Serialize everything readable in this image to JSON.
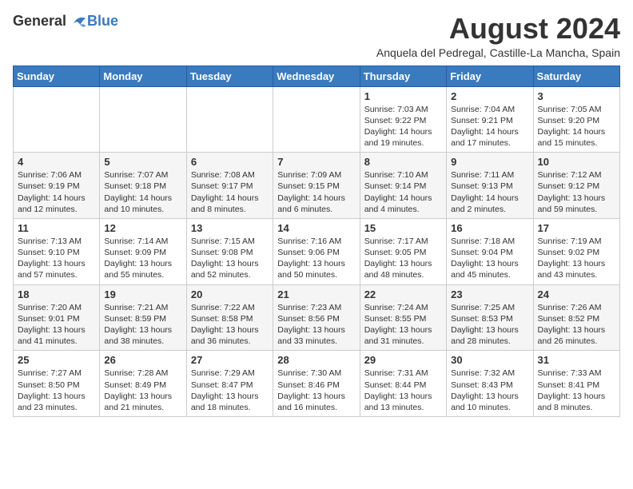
{
  "logo": {
    "general": "General",
    "blue": "Blue"
  },
  "title": "August 2024",
  "subtitle": "Anquela del Pedregal, Castille-La Mancha, Spain",
  "days_of_week": [
    "Sunday",
    "Monday",
    "Tuesday",
    "Wednesday",
    "Thursday",
    "Friday",
    "Saturday"
  ],
  "weeks": [
    [
      {
        "day": "",
        "info": ""
      },
      {
        "day": "",
        "info": ""
      },
      {
        "day": "",
        "info": ""
      },
      {
        "day": "",
        "info": ""
      },
      {
        "day": "1",
        "info": "Sunrise: 7:03 AM\nSunset: 9:22 PM\nDaylight: 14 hours and 19 minutes."
      },
      {
        "day": "2",
        "info": "Sunrise: 7:04 AM\nSunset: 9:21 PM\nDaylight: 14 hours and 17 minutes."
      },
      {
        "day": "3",
        "info": "Sunrise: 7:05 AM\nSunset: 9:20 PM\nDaylight: 14 hours and 15 minutes."
      }
    ],
    [
      {
        "day": "4",
        "info": "Sunrise: 7:06 AM\nSunset: 9:19 PM\nDaylight: 14 hours and 12 minutes."
      },
      {
        "day": "5",
        "info": "Sunrise: 7:07 AM\nSunset: 9:18 PM\nDaylight: 14 hours and 10 minutes."
      },
      {
        "day": "6",
        "info": "Sunrise: 7:08 AM\nSunset: 9:17 PM\nDaylight: 14 hours and 8 minutes."
      },
      {
        "day": "7",
        "info": "Sunrise: 7:09 AM\nSunset: 9:15 PM\nDaylight: 14 hours and 6 minutes."
      },
      {
        "day": "8",
        "info": "Sunrise: 7:10 AM\nSunset: 9:14 PM\nDaylight: 14 hours and 4 minutes."
      },
      {
        "day": "9",
        "info": "Sunrise: 7:11 AM\nSunset: 9:13 PM\nDaylight: 14 hours and 2 minutes."
      },
      {
        "day": "10",
        "info": "Sunrise: 7:12 AM\nSunset: 9:12 PM\nDaylight: 13 hours and 59 minutes."
      }
    ],
    [
      {
        "day": "11",
        "info": "Sunrise: 7:13 AM\nSunset: 9:10 PM\nDaylight: 13 hours and 57 minutes."
      },
      {
        "day": "12",
        "info": "Sunrise: 7:14 AM\nSunset: 9:09 PM\nDaylight: 13 hours and 55 minutes."
      },
      {
        "day": "13",
        "info": "Sunrise: 7:15 AM\nSunset: 9:08 PM\nDaylight: 13 hours and 52 minutes."
      },
      {
        "day": "14",
        "info": "Sunrise: 7:16 AM\nSunset: 9:06 PM\nDaylight: 13 hours and 50 minutes."
      },
      {
        "day": "15",
        "info": "Sunrise: 7:17 AM\nSunset: 9:05 PM\nDaylight: 13 hours and 48 minutes."
      },
      {
        "day": "16",
        "info": "Sunrise: 7:18 AM\nSunset: 9:04 PM\nDaylight: 13 hours and 45 minutes."
      },
      {
        "day": "17",
        "info": "Sunrise: 7:19 AM\nSunset: 9:02 PM\nDaylight: 13 hours and 43 minutes."
      }
    ],
    [
      {
        "day": "18",
        "info": "Sunrise: 7:20 AM\nSunset: 9:01 PM\nDaylight: 13 hours and 41 minutes."
      },
      {
        "day": "19",
        "info": "Sunrise: 7:21 AM\nSunset: 8:59 PM\nDaylight: 13 hours and 38 minutes."
      },
      {
        "day": "20",
        "info": "Sunrise: 7:22 AM\nSunset: 8:58 PM\nDaylight: 13 hours and 36 minutes."
      },
      {
        "day": "21",
        "info": "Sunrise: 7:23 AM\nSunset: 8:56 PM\nDaylight: 13 hours and 33 minutes."
      },
      {
        "day": "22",
        "info": "Sunrise: 7:24 AM\nSunset: 8:55 PM\nDaylight: 13 hours and 31 minutes."
      },
      {
        "day": "23",
        "info": "Sunrise: 7:25 AM\nSunset: 8:53 PM\nDaylight: 13 hours and 28 minutes."
      },
      {
        "day": "24",
        "info": "Sunrise: 7:26 AM\nSunset: 8:52 PM\nDaylight: 13 hours and 26 minutes."
      }
    ],
    [
      {
        "day": "25",
        "info": "Sunrise: 7:27 AM\nSunset: 8:50 PM\nDaylight: 13 hours and 23 minutes."
      },
      {
        "day": "26",
        "info": "Sunrise: 7:28 AM\nSunset: 8:49 PM\nDaylight: 13 hours and 21 minutes."
      },
      {
        "day": "27",
        "info": "Sunrise: 7:29 AM\nSunset: 8:47 PM\nDaylight: 13 hours and 18 minutes."
      },
      {
        "day": "28",
        "info": "Sunrise: 7:30 AM\nSunset: 8:46 PM\nDaylight: 13 hours and 16 minutes."
      },
      {
        "day": "29",
        "info": "Sunrise: 7:31 AM\nSunset: 8:44 PM\nDaylight: 13 hours and 13 minutes."
      },
      {
        "day": "30",
        "info": "Sunrise: 7:32 AM\nSunset: 8:43 PM\nDaylight: 13 hours and 10 minutes."
      },
      {
        "day": "31",
        "info": "Sunrise: 7:33 AM\nSunset: 8:41 PM\nDaylight: 13 hours and 8 minutes."
      }
    ]
  ]
}
